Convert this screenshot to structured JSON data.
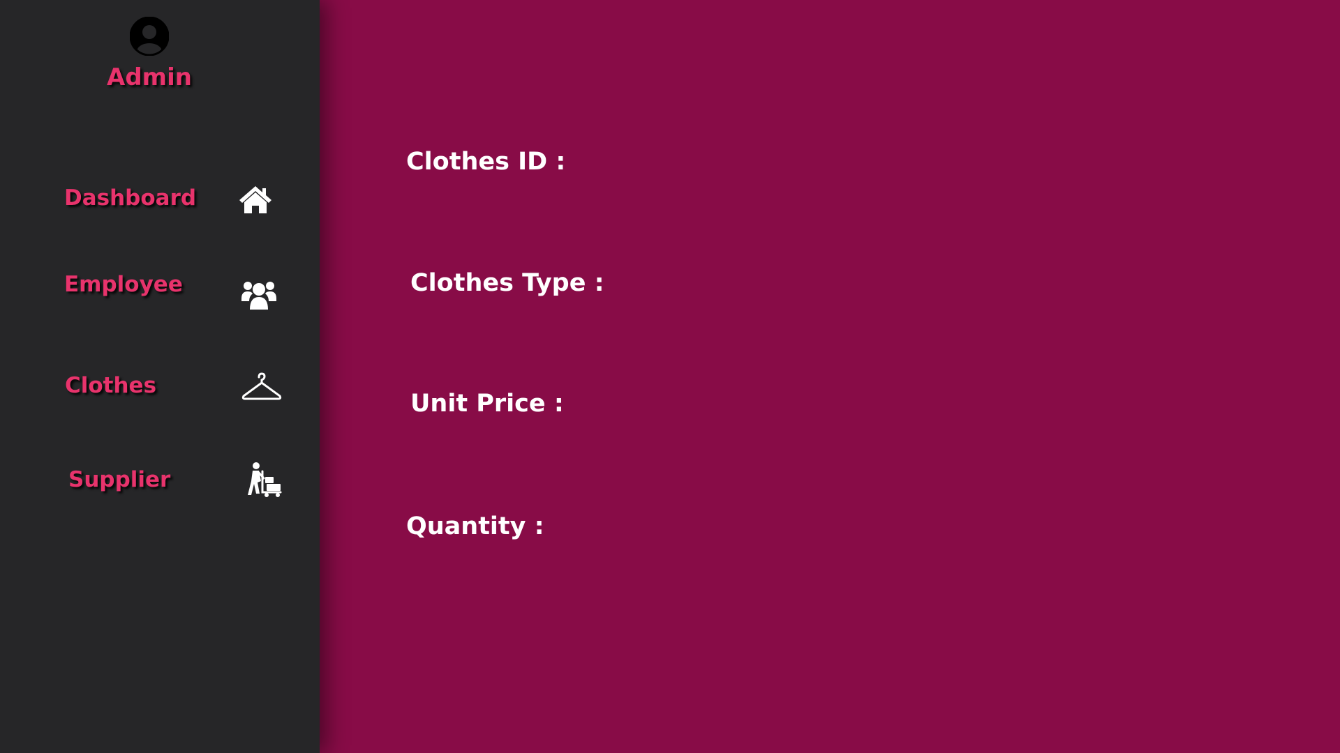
{
  "sidebar": {
    "user": {
      "name": "Admin",
      "avatar_icon": "user-avatar-icon"
    },
    "items": [
      {
        "label": "Dashboard",
        "icon": "home-icon"
      },
      {
        "label": "Employee",
        "icon": "users-icon"
      },
      {
        "label": "Clothes",
        "icon": "hanger-icon"
      },
      {
        "label": "Supplier",
        "icon": "delivery-cart-icon"
      }
    ]
  },
  "form": {
    "fields": [
      {
        "label": "Clothes ID :"
      },
      {
        "label": "Clothes Type :"
      },
      {
        "label": "Unit Price :"
      },
      {
        "label": "Quantity :"
      }
    ]
  },
  "colors": {
    "sidebar_bg": "#262628",
    "main_bg": "#880c47",
    "accent": "#e8336c",
    "text": "#ffffff"
  }
}
